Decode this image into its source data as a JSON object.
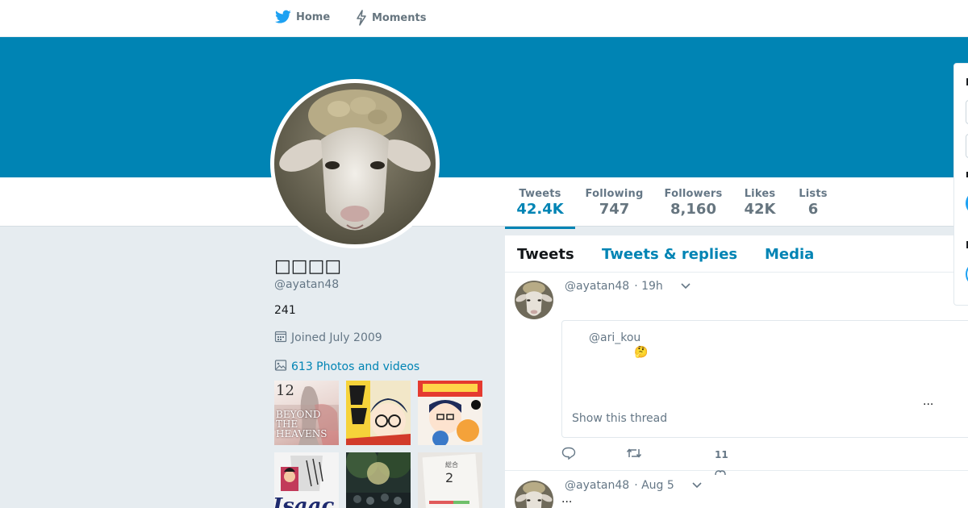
{
  "nav": {
    "home_label": "Home",
    "moments_label": "Moments",
    "accent": "#1da1f2"
  },
  "banner": {
    "color": "#0084b4"
  },
  "profile": {
    "name": "□□□□",
    "handle": "@ayatan48",
    "bio": "241",
    "joined": "Joined July 2009",
    "photos_link": "613 Photos and videos"
  },
  "stats": [
    {
      "label": "Tweets",
      "value": "42.4K"
    },
    {
      "label": "Following",
      "value": "747"
    },
    {
      "label": "Followers",
      "value": "8,160"
    },
    {
      "label": "Likes",
      "value": "42K"
    },
    {
      "label": "Lists",
      "value": "6"
    }
  ],
  "tabs": [
    {
      "label": "Tweets"
    },
    {
      "label": "Tweets & replies"
    },
    {
      "label": "Media"
    }
  ],
  "tweets": [
    {
      "handle": "@ayatan48",
      "time": "· 19h",
      "quote_handle": "@ari_kou",
      "quote_emoji": "🤔",
      "quote_ellipsis": "...",
      "show_thread": "Show this thread",
      "like_count": "11"
    },
    {
      "handle": "@ayatan48",
      "time": "· Aug 5",
      "text": "..."
    }
  ],
  "thumbnails": [
    {
      "caption": "12",
      "title": "BEYOND THE HEAVENS"
    },
    {
      "caption": "",
      "title": ""
    },
    {
      "caption": "",
      "title": ""
    },
    {
      "caption": "",
      "title": "Isaac"
    },
    {
      "caption": "",
      "title": ""
    },
    {
      "caption": "総合",
      "title": "2"
    }
  ],
  "side_card": {
    "frag1": "I",
    "frag2": "m",
    "frag3": "I"
  }
}
